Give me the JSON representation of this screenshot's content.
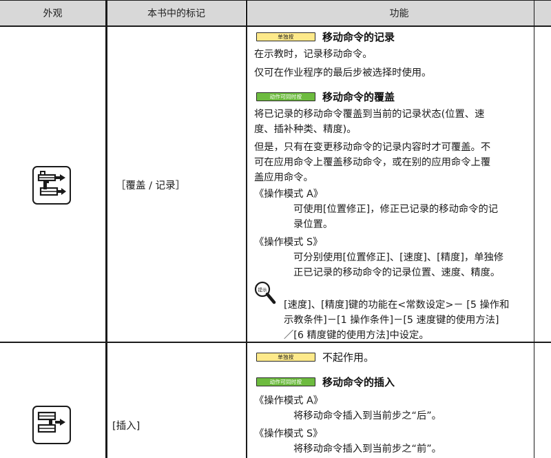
{
  "header": {
    "col_appearance": "外观",
    "col_mark": "本书中的标记",
    "col_function": "功能"
  },
  "row1": {
    "icon_name": "overwrite-record-key-icon",
    "mark": "［覆盖 / 记录］",
    "section1": {
      "tag": "单独按",
      "title": "移动命令的记录",
      "lines": [
        "在示教时，记录移动命令。",
        "仅可在作业程序的最后步被选择时使用。"
      ]
    },
    "section2": {
      "tag": "动作可同时按",
      "title": "移动命令的覆盖",
      "para1": [
        "将已记录的移动命令覆盖到当前的记录状态(位置、速",
        "度、插补种类、精度)。"
      ],
      "para2": [
        "但是，只有在变更移动命令的记录内容时才可覆盖。不",
        "可在应用命令上覆盖移动命令，或在别的应用命令上覆",
        "盖应用命令。"
      ],
      "modeA_label": "《操作模式 A》",
      "modeA_text": [
        "可使用[位置修正]，修正已记录的移动命令的记",
        "录位置。"
      ],
      "modeS_label": "《操作模式 S》",
      "modeS_text": [
        "可分别使用[位置修正]、[速度]、[精度]，单独修",
        "正已记录的移动命令的记录位置、速度、精度。"
      ],
      "hint_icon_label": "提示",
      "hint_text": [
        "[速度]、[精度]键的功能在<常数设定>－ [5 操作和",
        "示教条件]－[1 操作条件]－[5 速度键的使用方法]",
        "／[6 精度键的使用方法]中设定。"
      ]
    }
  },
  "row2": {
    "icon_name": "insert-key-icon",
    "mark": "[插入]",
    "section1": {
      "tag": "单独按",
      "title": "不起作用。"
    },
    "section2": {
      "tag": "动作可同时按",
      "title": "移动命令的插入",
      "modeA_label": "《操作模式 A》",
      "modeA_text": "将移动命令插入到当前步之“后”。",
      "modeS_label": "《操作模式 S》",
      "modeS_text": "将移动命令插入到当前步之“前”。"
    }
  },
  "colors": {
    "header_bg": "#d8d8d8",
    "tag_yellow": "#fde98a",
    "tag_green": "#6dbb3f"
  }
}
